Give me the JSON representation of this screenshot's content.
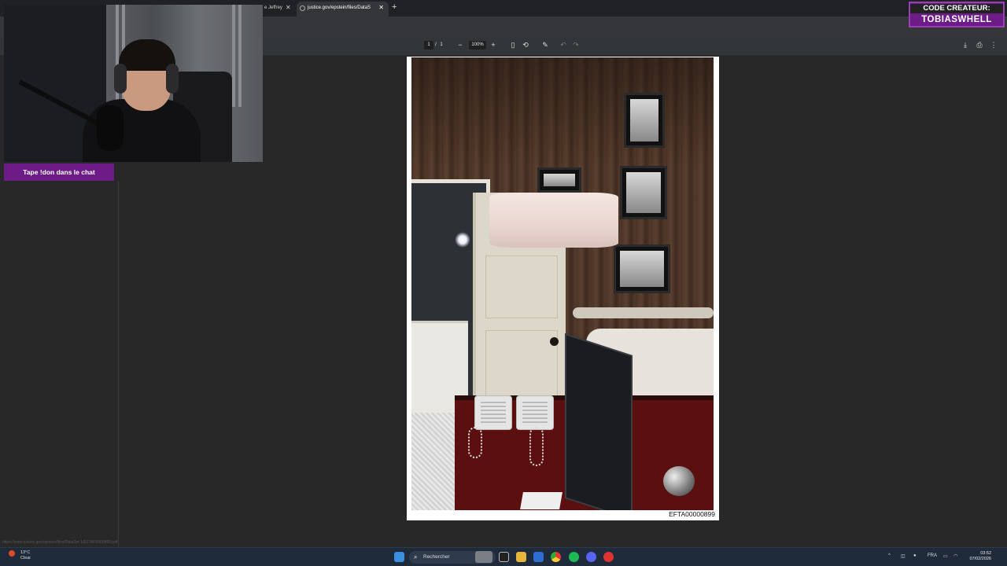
{
  "browser": {
    "tabs": [
      {
        "label": "e Jeffrey",
        "close": "✕"
      },
      {
        "label": "justice.gov/epstein/files/DataS",
        "close": "✕"
      }
    ],
    "new_tab": "+"
  },
  "pdf_toolbar": {
    "page_current": "1",
    "page_separator": "/",
    "page_total": "1",
    "zoom": "100%",
    "zoom_out": "−",
    "zoom_in": "+"
  },
  "overlay": {
    "chat_cta": "Tape !don dans le chat",
    "creator_line1": "CODE CREATEUR:",
    "creator_line2": "TOBIASWHELL"
  },
  "document": {
    "page_id": "EFTA00000899"
  },
  "status_url": "https://www.justice.gov/epstein/files/DataSet 1/EFTA00000899.pdf",
  "taskbar": {
    "weather_temp": "13°C",
    "weather_desc": "Clear",
    "search_placeholder": "Rechercher",
    "language": "FRA",
    "time": "03:52",
    "date": "07/02/2026"
  },
  "colors": {
    "overlay_purple": "#6d1b86",
    "pdf_background": "#282828",
    "taskbar": "#1f2b3a"
  }
}
